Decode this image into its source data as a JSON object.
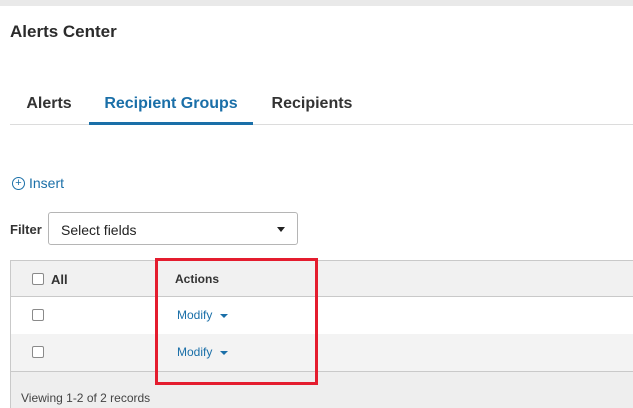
{
  "page": {
    "title": "Alerts Center"
  },
  "tabs": [
    {
      "label": "Alerts",
      "active": false
    },
    {
      "label": "Recipient Groups",
      "active": true
    },
    {
      "label": "Recipients",
      "active": false
    }
  ],
  "toolbar": {
    "insert_label": "Insert",
    "insert_icon": "plus-circle-icon"
  },
  "filter": {
    "label": "Filter",
    "select_value": "Select fields"
  },
  "grid": {
    "columns": {
      "select_all_label": "All",
      "actions_label": "Actions"
    },
    "rows": [
      {
        "checked": false,
        "action_label": "Modify"
      },
      {
        "checked": false,
        "action_label": "Modify"
      }
    ],
    "footer_text": "Viewing 1-2 of 2 records"
  },
  "colors": {
    "accent": "#1a6fa8",
    "highlight": "#e41c2e"
  }
}
